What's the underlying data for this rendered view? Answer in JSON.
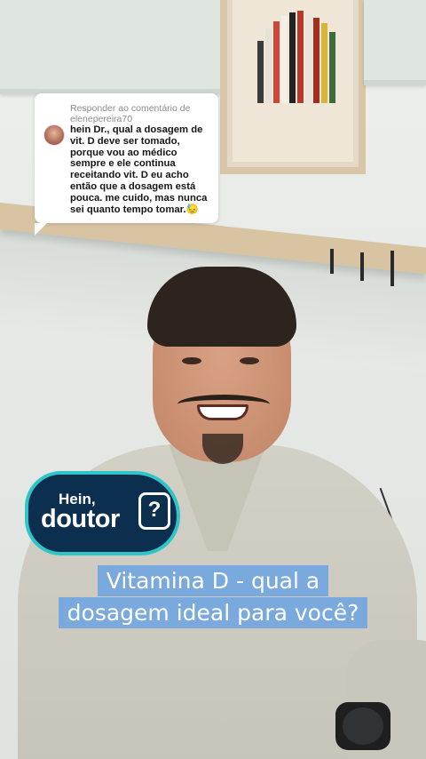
{
  "comment": {
    "reply_to": "Responder ao comentário de elenepereira70",
    "text": "hein Dr., qual a dosagem de vit. D deve ser tomado, porque vou ao médico sempre e ele continua receitando vit. D eu acho então que a dosagem está pouca. me cuido, mas nunca sei quanto tempo tomar.😓"
  },
  "logo": {
    "line1": "Hein,",
    "line2": "doutor",
    "mark": "?"
  },
  "caption": {
    "line1": "Vitamina D - qual a",
    "line2": "dosagem ideal para você?"
  },
  "colors": {
    "caption_bg": "#79a9dd",
    "logo_bg": "#0d2f4f",
    "logo_border": "#2ec4c8"
  }
}
